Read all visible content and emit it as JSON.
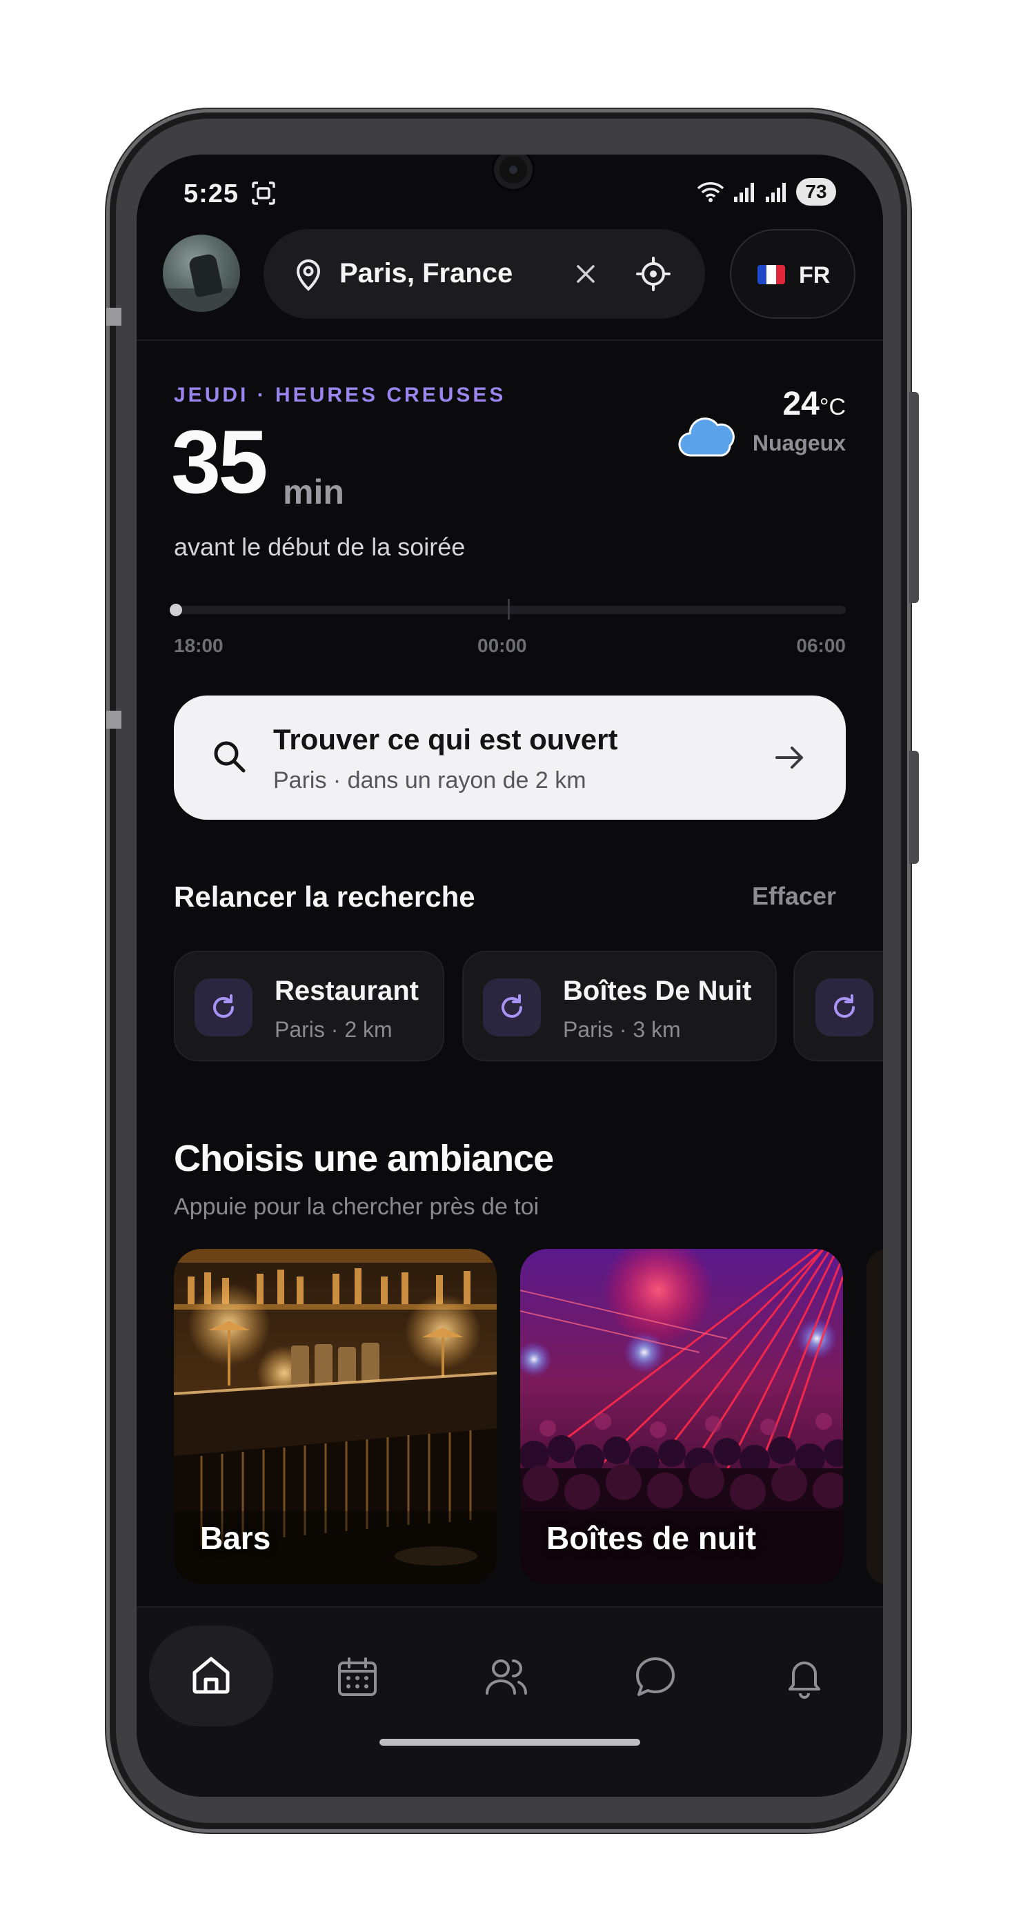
{
  "status_bar": {
    "time": "5:25",
    "battery": "73",
    "icons": [
      "screenshot-icon",
      "wifi-icon",
      "signal-icon",
      "signal-icon",
      "battery-icon"
    ]
  },
  "top_bar": {
    "location": "Paris, France",
    "language": "FR",
    "icons": [
      "avatar",
      "location-pin-icon",
      "close-icon",
      "crosshair-icon",
      "france-flag-icon"
    ]
  },
  "hero": {
    "kicker": "JEUDI · HEURES CREUSES",
    "countdown_value": "35",
    "countdown_unit": "min",
    "subtitle": "avant le début de la soirée",
    "weather": {
      "temperature": "24",
      "unit": "°C",
      "condition": "Nuageux",
      "icon": "cloud-icon"
    },
    "timeline": {
      "labels": [
        "18:00",
        "00:00",
        "06:00"
      ],
      "progress": 0
    }
  },
  "find_card": {
    "title": "Trouver ce qui est ouvert",
    "subtitle": "Paris · dans un rayon de 2 km",
    "icons": [
      "search-icon",
      "arrow-right-icon"
    ]
  },
  "recent": {
    "title": "Relancer la recherche",
    "clear_label": "Effacer",
    "items": [
      {
        "title": "Restaurant",
        "subtitle": "Paris · 2 km",
        "icon": "refresh-icon"
      },
      {
        "title": "Boîtes De Nuit",
        "subtitle": "Paris · 3 km",
        "icon": "refresh-icon"
      },
      {
        "title": "",
        "subtitle": "",
        "icon": "refresh-icon"
      }
    ]
  },
  "ambiance": {
    "title": "Choisis une ambiance",
    "subtitle": "Appuie pour la chercher près de toi",
    "cards": [
      {
        "label": "Bars"
      },
      {
        "label": "Boîtes de nuit"
      }
    ]
  },
  "bottom_nav": {
    "items": [
      "home-icon",
      "calendar-icon",
      "users-icon",
      "chat-icon",
      "bell-icon"
    ],
    "active": "home-icon"
  },
  "colors": {
    "background": "#0b0b0d",
    "accent": "#9b86f0",
    "card_light": "#f2f2f4",
    "weather_cloud": "#5aa2ea"
  }
}
